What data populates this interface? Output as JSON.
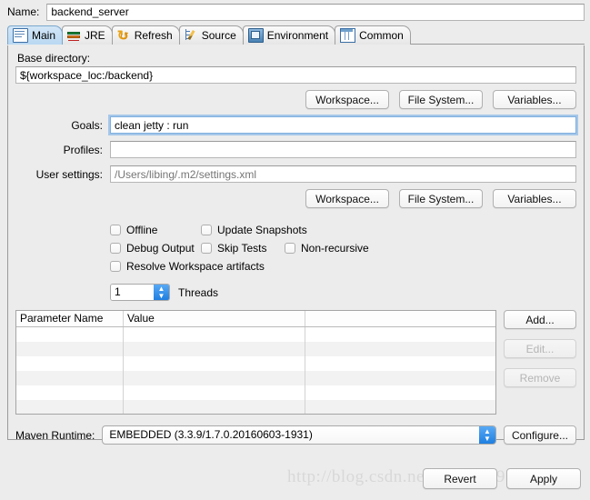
{
  "name_row": {
    "label": "Name:",
    "value": "backend_server"
  },
  "tabs": [
    {
      "label": "Main",
      "icon": "document-icon",
      "icon_class": "ic-main",
      "active": true
    },
    {
      "label": "JRE",
      "icon": "books-icon",
      "icon_class": "ic-jre",
      "active": false
    },
    {
      "label": "Refresh",
      "icon": "refresh-icon",
      "icon_class": "ic-refresh",
      "active": false
    },
    {
      "label": "Source",
      "icon": "source-tree-icon",
      "icon_class": "ic-source",
      "active": false
    },
    {
      "label": "Environment",
      "icon": "monitor-icon",
      "icon_class": "ic-env",
      "active": false
    },
    {
      "label": "Common",
      "icon": "table-icon",
      "icon_class": "ic-common",
      "active": false
    }
  ],
  "base_directory": {
    "label": "Base directory:",
    "value": "${workspace_loc:/backend}",
    "buttons": [
      "Workspace...",
      "File System...",
      "Variables..."
    ]
  },
  "fields": {
    "goals": {
      "label": "Goals:",
      "value": "clean jetty : run",
      "focused": true
    },
    "profiles": {
      "label": "Profiles:",
      "value": ""
    },
    "user_settings": {
      "label": "User settings:",
      "value": "",
      "placeholder": "/Users/libing/.m2/settings.xml"
    },
    "buttons": [
      "Workspace...",
      "File System...",
      "Variables..."
    ]
  },
  "checkboxes": {
    "row1": [
      {
        "label": "Offline",
        "checked": false
      },
      {
        "label": "Update Snapshots",
        "checked": false
      }
    ],
    "row2": [
      {
        "label": "Debug Output",
        "checked": false
      },
      {
        "label": "Skip Tests",
        "checked": false
      },
      {
        "label": "Non-recursive",
        "checked": false
      }
    ],
    "row3": [
      {
        "label": "Resolve Workspace artifacts",
        "checked": false
      }
    ]
  },
  "threads": {
    "value": "1",
    "label": "Threads"
  },
  "parameters_table": {
    "columns": [
      "Parameter Name",
      "Value",
      ""
    ],
    "rows": [],
    "empty_row_count": 6,
    "buttons": [
      {
        "label": "Add...",
        "enabled": true
      },
      {
        "label": "Edit...",
        "enabled": false
      },
      {
        "label": "Remove",
        "enabled": false
      }
    ]
  },
  "maven_runtime": {
    "label": "Maven Runtime:",
    "value": "EMBEDDED (3.3.9/1.7.0.20160603-1931)",
    "configure_label": "Configure..."
  },
  "bottom_buttons": [
    {
      "label": "Revert",
      "enabled": true
    },
    {
      "label": "Apply",
      "enabled": true
    }
  ],
  "watermark": {
    "text": "http://blog.csdn.net/libing9191"
  },
  "colors": {
    "accent_blue": "#1f7fe0",
    "tab_active": "#b9d8f2",
    "focus_ring": "#7fb0e0",
    "window_bg": "#ececec"
  }
}
